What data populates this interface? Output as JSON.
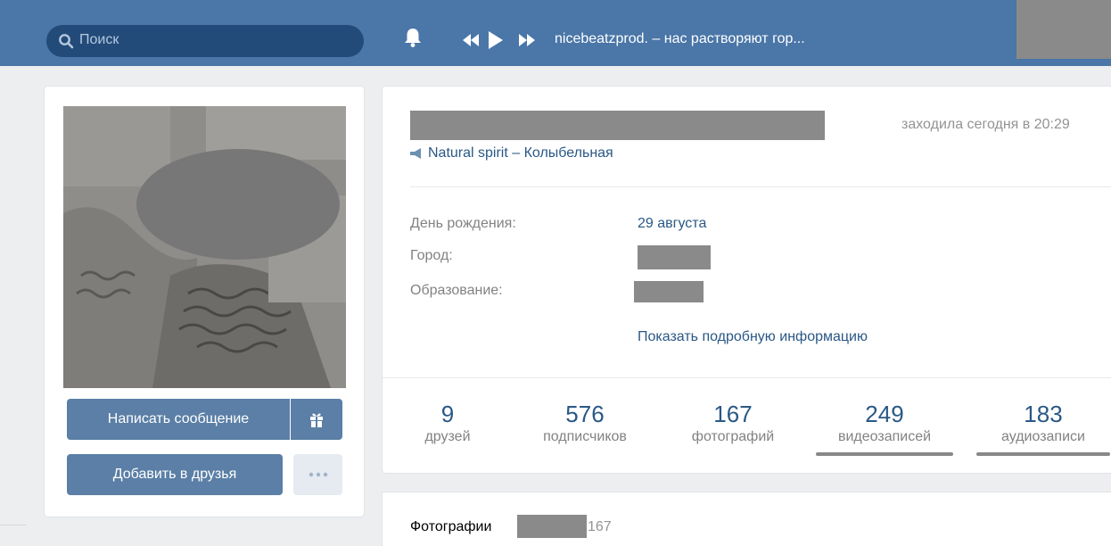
{
  "header": {
    "search_placeholder": "Поиск",
    "now_playing": "nicebeatzprod. – нас растворяют гор..."
  },
  "profile": {
    "last_seen": "заходила сегодня в 20:29",
    "status": "Natural spirit – Колыбельная",
    "info": {
      "birthday_label": "День рождения:",
      "birthday_value": "29 августа",
      "city_label": "Город:",
      "education_label": "Образование:",
      "show_more": "Показать подробную информацию"
    },
    "counters": [
      {
        "count": "9",
        "label": "друзей"
      },
      {
        "count": "576",
        "label": "подписчиков"
      },
      {
        "count": "167",
        "label": "фотографий"
      },
      {
        "count": "249",
        "label": "видеозаписей"
      },
      {
        "count": "183",
        "label": "аудиозаписи"
      }
    ]
  },
  "actions": {
    "message": "Написать сообщение",
    "add_friend": "Добавить в друзья"
  },
  "photos": {
    "title": "Фотографии",
    "count": "167"
  },
  "colors": {
    "header_bg": "#4a76a8",
    "link": "#2a5885",
    "button": "#5b7fa6"
  }
}
